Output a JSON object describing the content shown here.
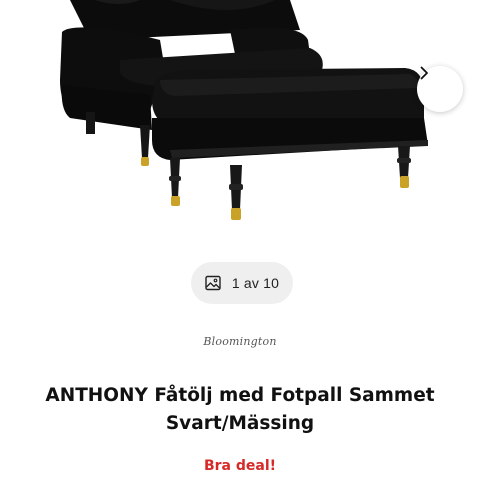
{
  "gallery": {
    "counter_text": "1 av 10"
  },
  "product": {
    "brand": "Bloomington",
    "title_line1": "ANTHONY Fåtölj med Fotpall Sammet",
    "title_line2": "Svart/Mässing",
    "deal_label": "Bra deal!"
  },
  "colors": {
    "deal": "#d62a2a",
    "pill_background": "#efefef"
  }
}
